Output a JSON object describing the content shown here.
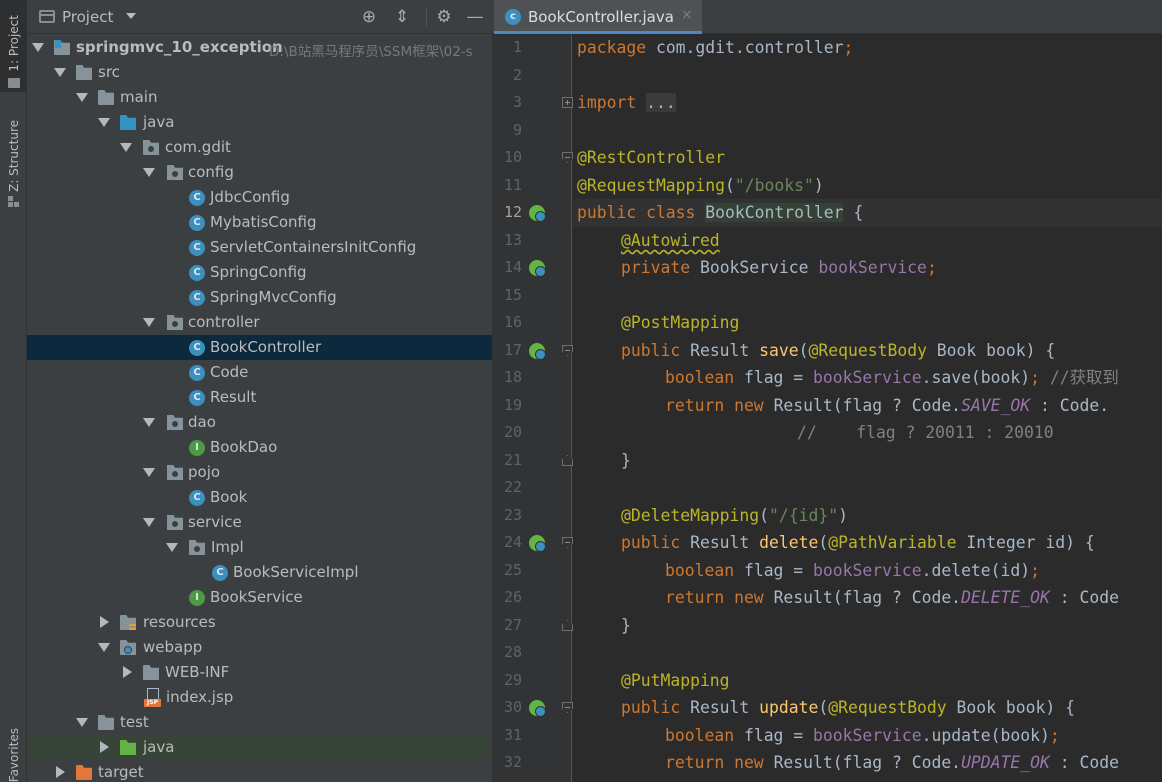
{
  "toolstrip": {
    "project_label": "1: Project",
    "structure_label": "Z: Structure",
    "favorites_label": "Favorites"
  },
  "project_panel": {
    "title": "Project",
    "tree": [
      {
        "label": "springmvc_10_exception",
        "path": "D:\\B站黑马程序员\\SSM框架\\02-s"
      },
      {
        "label": "src"
      },
      {
        "label": "main"
      },
      {
        "label": "java"
      },
      {
        "label": "com.gdit"
      },
      {
        "label": "config"
      },
      {
        "label": "JdbcConfig",
        "icon": "C"
      },
      {
        "label": "MybatisConfig",
        "icon": "C"
      },
      {
        "label": "ServletContainersInitConfig",
        "icon": "C"
      },
      {
        "label": "SpringConfig",
        "icon": "C"
      },
      {
        "label": "SpringMvcConfig",
        "icon": "C"
      },
      {
        "label": "controller"
      },
      {
        "label": "BookController",
        "icon": "C"
      },
      {
        "label": "Code",
        "icon": "C"
      },
      {
        "label": "Result",
        "icon": "C"
      },
      {
        "label": "dao"
      },
      {
        "label": "BookDao",
        "icon": "I"
      },
      {
        "label": "pojo"
      },
      {
        "label": "Book",
        "icon": "C"
      },
      {
        "label": "service"
      },
      {
        "label": "Impl"
      },
      {
        "label": "BookServiceImpl",
        "icon": "C"
      },
      {
        "label": "BookService",
        "icon": "I"
      },
      {
        "label": "resources"
      },
      {
        "label": "webapp"
      },
      {
        "label": "WEB-INF"
      },
      {
        "label": "index.jsp",
        "icon": "JSP"
      },
      {
        "label": "test"
      },
      {
        "label": "java"
      },
      {
        "label": "target"
      }
    ]
  },
  "editor": {
    "tab_label": "BookController.java",
    "tab_close": "×",
    "line_numbers": [
      "1",
      "2",
      "3",
      "9",
      "10",
      "11",
      "12",
      "13",
      "14",
      "15",
      "16",
      "17",
      "18",
      "19",
      "20",
      "21",
      "22",
      "23",
      "24",
      "25",
      "26",
      "27",
      "28",
      "29",
      "30",
      "31",
      "32"
    ],
    "current_line": "12",
    "code": {
      "l1_kw": "package",
      "l1_rest": " com.gdit.controller",
      "l1_semi": ";",
      "l3_kw": "import",
      "l3_fold": "...",
      "l10": "@RestController",
      "l11_ann": "@RequestMapping",
      "l11_open": "(",
      "l11_str": "\"/books\"",
      "l11_close": ")",
      "l12_kw": "public class ",
      "l12_name": "BookController",
      "l12_rest": " {",
      "l13": "@Autowired",
      "l14_kw": "private ",
      "l14_type": "BookService ",
      "l14_field": "bookService",
      "l14_semi": ";",
      "l16": "@PostMapping",
      "l17_kw": "public ",
      "l17_type": "Result ",
      "l17_method": "save",
      "l17_open": "(",
      "l17_ann": "@RequestBody",
      "l17_rest": " Book book) {",
      "l18_kw": "boolean ",
      "l18_var": "flag = ",
      "l18_field": "bookService",
      "l18_call": ".save(book)",
      "l18_semi": "; ",
      "l18_comment": "//获取到",
      "l19_kw": "return new ",
      "l19_call": "Result(flag ? Code.",
      "l19_const": "SAVE_OK",
      "l19_rest": " : Code.",
      "l20_comment": "//    flag ? 20011 : 20010",
      "l21": "}",
      "l23_ann": "@DeleteMapping",
      "l23_open": "(",
      "l23_str": "\"/{id}\"",
      "l23_close": ")",
      "l24_kw": "public ",
      "l24_type": "Result ",
      "l24_method": "delete",
      "l24_open": "(",
      "l24_ann": "@PathVariable",
      "l24_rest": " Integer id) {",
      "l25_kw": "boolean ",
      "l25_var": "flag = ",
      "l25_field": "bookService",
      "l25_call": ".delete(id)",
      "l25_semi": ";",
      "l26_kw": "return new ",
      "l26_call": "Result(flag ? Code.",
      "l26_const": "DELETE_OK",
      "l26_rest": " : Code",
      "l27": "}",
      "l29": "@PutMapping",
      "l30_kw": "public ",
      "l30_type": "Result ",
      "l30_method": "update",
      "l30_open": "(",
      "l30_ann": "@RequestBody",
      "l30_rest": " Book book) {",
      "l31_kw": "boolean ",
      "l31_var": "flag = ",
      "l31_field": "bookService",
      "l31_call": ".update(book)",
      "l31_semi": ";",
      "l32_kw": "return new ",
      "l32_call": "Result(flag ? Code.",
      "l32_const": "UPDATE_OK",
      "l32_rest": " : Code"
    }
  }
}
